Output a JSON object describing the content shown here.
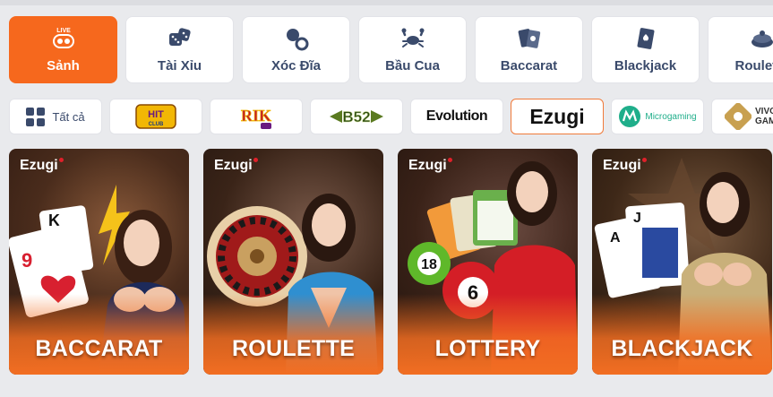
{
  "categories": [
    {
      "label": "Sảnh",
      "icon": "live-icon",
      "active": true,
      "badge": "LIVE"
    },
    {
      "label": "Tài Xỉu",
      "icon": "dice-icon",
      "active": false
    },
    {
      "label": "Xóc Đĩa",
      "icon": "disc-icon",
      "active": false
    },
    {
      "label": "Bầu Cua",
      "icon": "crab-icon",
      "active": false
    },
    {
      "label": "Baccarat",
      "icon": "cards-icon",
      "active": false
    },
    {
      "label": "Blackjack",
      "icon": "card-spade-icon",
      "active": false
    },
    {
      "label": "Roulette",
      "icon": "roulette-icon",
      "active": false
    }
  ],
  "providers": [
    {
      "label": "Tất cả",
      "icon": "grid-icon"
    },
    {
      "label": "HIT CLUB",
      "logo": "hitclub-logo"
    },
    {
      "label": "RIK",
      "logo": "rik-logo"
    },
    {
      "label": "B52",
      "logo": "b52-logo"
    },
    {
      "label": "Evolution",
      "logo": "evolution-logo"
    },
    {
      "label": "Ezugi",
      "logo": "ezugi-logo",
      "active": true
    },
    {
      "label": "Microgaming",
      "logo": "microgaming-logo"
    },
    {
      "label": "VIVO GAMING",
      "logo": "vivo-logo"
    }
  ],
  "games": [
    {
      "brand": "Ezugi",
      "title": "BACCARAT"
    },
    {
      "brand": "Ezugi",
      "title": "ROULETTE"
    },
    {
      "brand": "Ezugi",
      "title": "LOTTERY"
    },
    {
      "brand": "Ezugi",
      "title": "BLACKJACK"
    }
  ],
  "colors": {
    "accent": "#f6681d",
    "text": "#3a4a6b",
    "background": "#e9eaed"
  }
}
